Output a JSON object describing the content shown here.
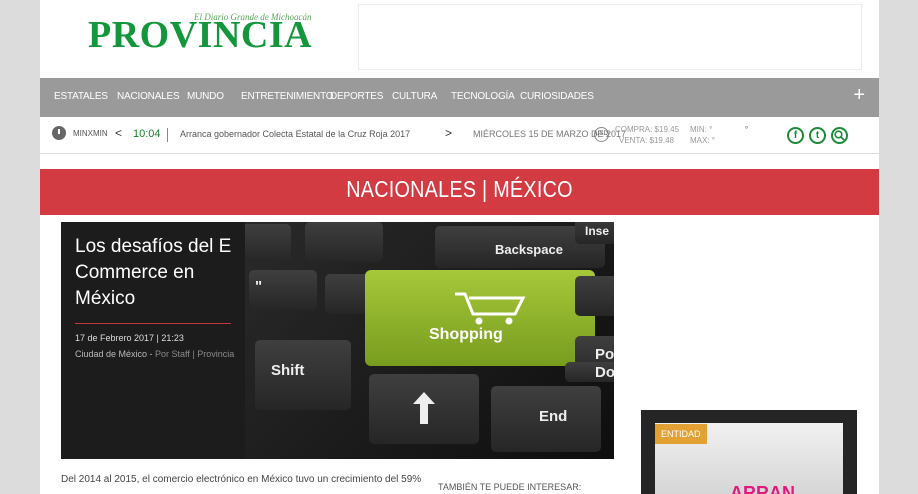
{
  "header": {
    "tagline": "El Diario Grande de Michoacán",
    "logo": "PROVINCIA"
  },
  "nav": {
    "items": [
      "Estatales",
      "Nacionales",
      "Mundo",
      "Entretenimiento",
      "Deportes",
      "Cultura",
      "Tecnología",
      "Curiosidades"
    ],
    "more_label": "+"
  },
  "ticker": {
    "location": "MINXMIN",
    "prev": "<",
    "next": ">",
    "time": "10:04",
    "headline": "Arranca gobernador Colecta Estatal de la Cruz Roja 2017",
    "date": "MIÉRCOLES 15 DE MARZO DE 2017",
    "currency_icon": "USD",
    "buy": "COMPRA: $19.45",
    "sell": "VENTA: $19.48",
    "min": "MIN: °",
    "max": "MAX: °",
    "temp": "°",
    "social": [
      "f",
      "t",
      "search"
    ]
  },
  "banner": {
    "section": "NACIONALES | MÉXICO"
  },
  "hero": {
    "title": "Los desafíos del E Commerce en México",
    "date": "17 de Febrero 2017 | 21:23",
    "location": "Ciudad de México - ",
    "author": "Por Staff | Provincia",
    "keys": [
      "Backspace",
      "Shopping",
      "Shift",
      "End",
      "Inse",
      "Po",
      "Do",
      "\""
    ]
  },
  "article": {
    "lead": "Del 2014 al 2015, el comercio electrónico en México tuvo un crecimiento del 59%",
    "also_label": "TAMBIÉN TE PUEDE INTERESAR:"
  },
  "sidebar": {
    "tag": "ENTIDAD",
    "img_text": "ARRAN"
  },
  "colors": {
    "brand_green": "#14963c",
    "nav_gray": "#9a9a9a",
    "banner_red": "#d23b41",
    "tag_orange": "#e3a033"
  }
}
